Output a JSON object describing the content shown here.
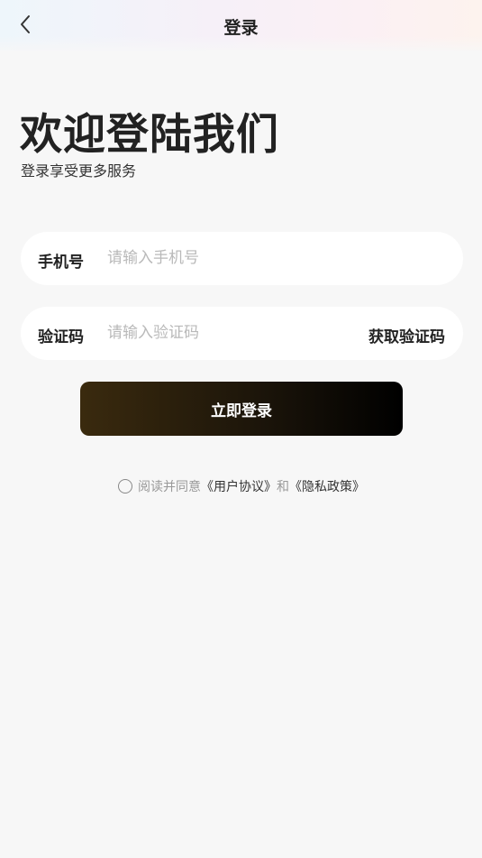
{
  "header": {
    "title": "登录",
    "back_icon": "chevron-left-icon"
  },
  "welcome": {
    "title": "欢迎登陆我们",
    "subtitle": "登录享受更多服务"
  },
  "phone_field": {
    "label": "手机号",
    "placeholder": "请输入手机号",
    "value": ""
  },
  "code_field": {
    "label": "验证码",
    "placeholder": "请输入验证码",
    "value": "",
    "get_code_label": "获取验证码"
  },
  "login_button": {
    "label": "立即登录"
  },
  "agreement": {
    "checked": false,
    "prefix": "阅读并同意",
    "user_agreement": "《用户协议》",
    "conjunction": "和",
    "privacy_policy": "《隐私政策》"
  },
  "colors": {
    "background": "#f7f7f7",
    "button_start": "#3a2a0e",
    "button_end": "#000000",
    "placeholder": "#b9b9b9"
  }
}
